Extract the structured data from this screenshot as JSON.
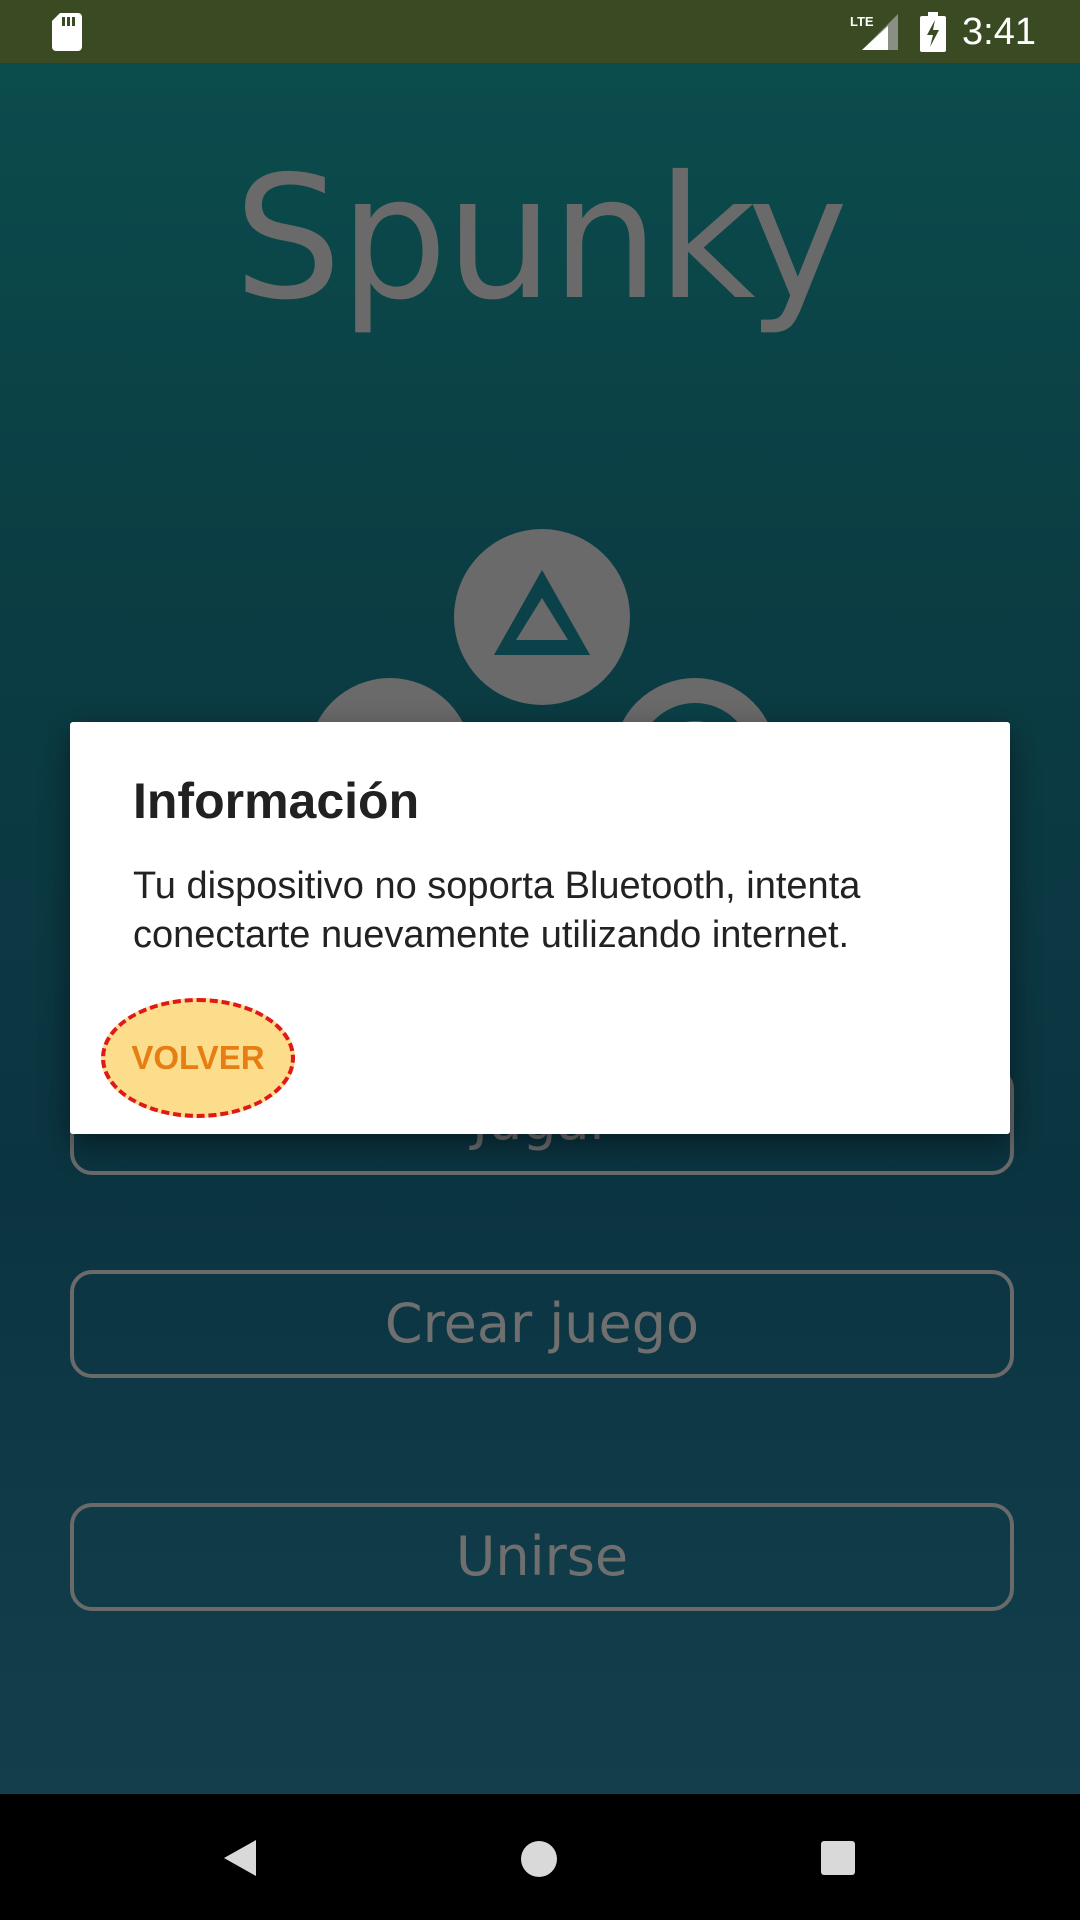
{
  "status_bar": {
    "time": "3:41",
    "network_label": "LTE",
    "icons": [
      "sd-card-icon",
      "lte-signal-icon",
      "battery-charging-icon"
    ]
  },
  "app": {
    "title": "Spunky",
    "buttons": {
      "jugar": "Jugar",
      "crear": "Crear juego",
      "unirse": "Unirse"
    }
  },
  "dialog": {
    "title": "Información",
    "message": "Tu dispositivo no soporta Bluetooth, intenta conectarte nuevamente utilizando internet.",
    "volver_label": "VOLVER"
  },
  "nav_bar": {
    "icons": [
      "back-icon",
      "home-icon",
      "recents-icon"
    ]
  },
  "colors": {
    "status_bar_bg": "#3a4a22",
    "app_bg": "#0b3d43",
    "dimmed_text": "#6a6a6a",
    "dialog_bg": "#ffffff",
    "volver_text": "#e67e14",
    "volver_highlight": "#fcdd8c",
    "volver_outline": "#e01818"
  }
}
